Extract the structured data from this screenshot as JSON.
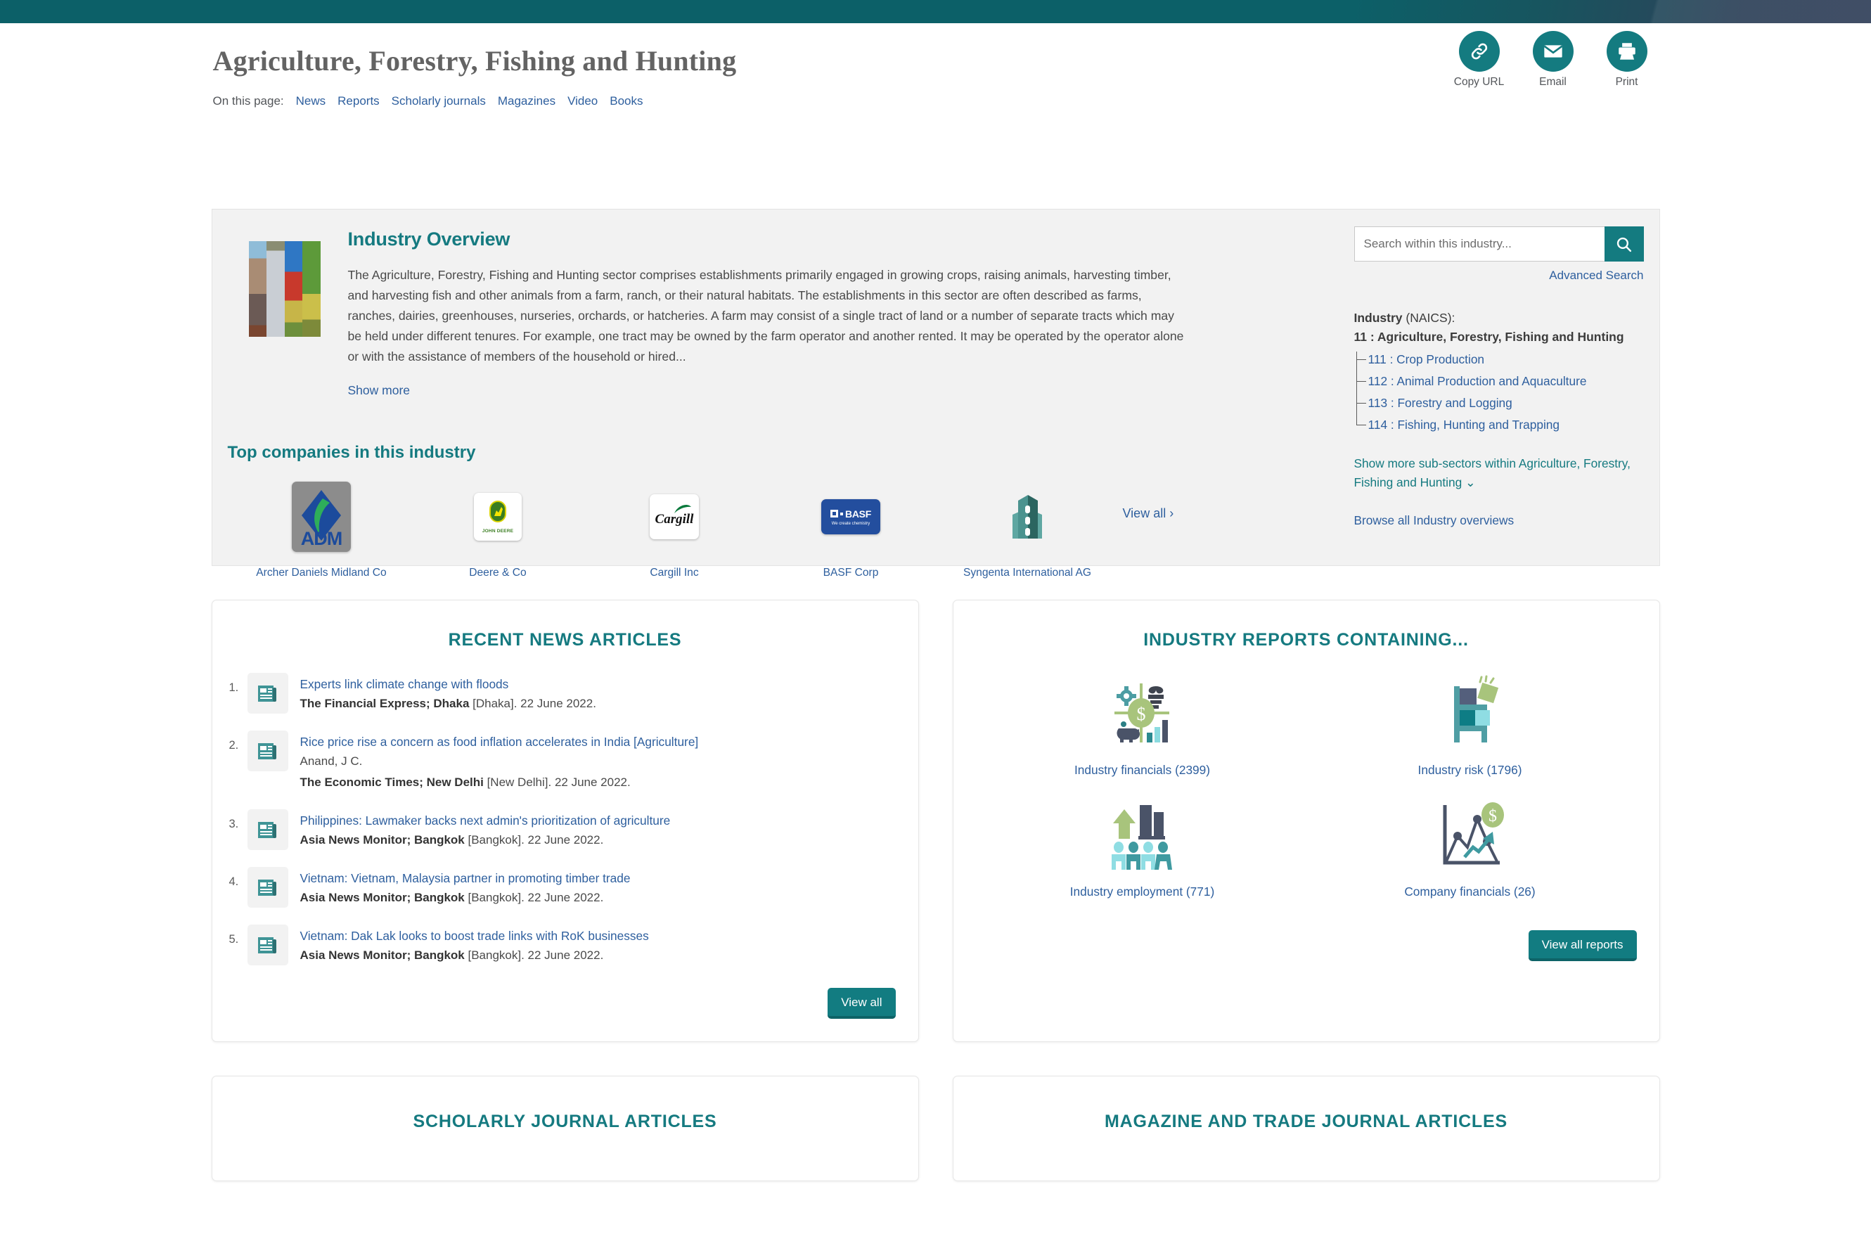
{
  "header": {
    "title": "Agriculture, Forestry, Fishing and Hunting",
    "actions": [
      {
        "label": "Copy URL",
        "icon": "link-icon"
      },
      {
        "label": "Email",
        "icon": "envelope-icon"
      },
      {
        "label": "Print",
        "icon": "printer-icon"
      }
    ]
  },
  "on_this_page": {
    "label": "On this page:",
    "links": [
      "News",
      "Reports",
      "Scholarly journals",
      "Magazines",
      "Video",
      "Books"
    ]
  },
  "overview": {
    "title": "Industry Overview",
    "text": "The Agriculture, Forestry, Fishing and Hunting sector comprises establishments primarily engaged in growing crops, raising animals, harvesting timber, and harvesting fish and other animals from a farm, ranch, or their natural habitats. The establishments in this sector are often described as farms, ranches, dairies, greenhouses, nurseries, orchards, or hatcheries. A farm may consist of a single tract of land or a number of separate tracts which may be held under different tenures. For example, one tract may be owned by the farm operator and another rented. It may be operated by the operator alone or with the assistance of members of the household or hired...",
    "show_more": "Show more",
    "top_companies_title": "Top companies in this industry",
    "view_all": "View all  ›",
    "companies": [
      {
        "name": "Archer Daniels Midland Co",
        "logo": "adm-logo"
      },
      {
        "name": "Deere & Co",
        "logo": "john-deere-logo"
      },
      {
        "name": "Cargill Inc",
        "logo": "cargill-logo"
      },
      {
        "name": "BASF Corp",
        "logo": "basf-logo"
      },
      {
        "name": "Syngenta International AG",
        "logo": "building-placeholder-icon"
      }
    ]
  },
  "rail": {
    "search_placeholder": "Search within this industry...",
    "search_value": "",
    "advanced_search": "Advanced Search",
    "naics_label_bold": "Industry",
    "naics_label_rest": " (NAICS):",
    "naics_root": "11 : Agriculture, Forestry, Fishing and Hunting",
    "naics_children": [
      "111 : Crop Production",
      "112 : Animal Production and Aquaculture",
      "113 : Forestry and Logging",
      "114 : Fishing, Hunting and Trapping"
    ],
    "show_more_subsectors": "Show more sub-sectors within Agriculture, Forestry, Fishing and Hunting ⌄",
    "browse_all": "Browse all Industry overviews"
  },
  "news_card": {
    "title": "RECENT NEWS ARTICLES",
    "view_all_button": "View all",
    "items": [
      {
        "num": "1.",
        "title": "Experts link climate change with floods",
        "author": "",
        "source": "The Financial Express; Dhaka",
        "detail": " [Dhaka]. 22 June 2022."
      },
      {
        "num": "2.",
        "title": "Rice price rise a concern as food inflation accelerates in India [Agriculture]",
        "author": "Anand, J C.",
        "source": "The Economic Times; New Delhi",
        "detail": " [New Delhi]. 22 June 2022."
      },
      {
        "num": "3.",
        "title": "Philippines: Lawmaker backs next admin's prioritization of agriculture",
        "author": "",
        "source": "Asia News Monitor; Bangkok",
        "detail": " [Bangkok]. 22 June 2022."
      },
      {
        "num": "4.",
        "title": "Vietnam: Vietnam, Malaysia partner in promoting timber trade",
        "author": "",
        "source": "Asia News Monitor; Bangkok",
        "detail": " [Bangkok]. 22 June 2022."
      },
      {
        "num": "5.",
        "title": "Vietnam: Dak Lak looks to boost trade links with RoK businesses",
        "author": "",
        "source": "Asia News Monitor; Bangkok",
        "detail": " [Bangkok]. 22 June 2022."
      }
    ]
  },
  "reports_card": {
    "title": "INDUSTRY REPORTS CONTAINING...",
    "view_all_button": "View all reports",
    "items": [
      {
        "label": "Industry financials (2399)",
        "icon": "industry-financials-icon"
      },
      {
        "label": "Industry risk (1796)",
        "icon": "industry-risk-icon"
      },
      {
        "label": "Industry employment (771)",
        "icon": "industry-employment-icon"
      },
      {
        "label": "Company financials (26)",
        "icon": "company-financials-icon"
      }
    ]
  },
  "bottom_cards": [
    {
      "title": "SCHOLARLY JOURNAL ARTICLES"
    },
    {
      "title": "MAGAZINE AND TRADE JOURNAL ARTICLES"
    }
  ],
  "colors": {
    "teal": "#147b80",
    "link_blue": "#2e5f9e",
    "panel_gray": "#f2f2f2",
    "topbar_navy": "#32415a"
  }
}
